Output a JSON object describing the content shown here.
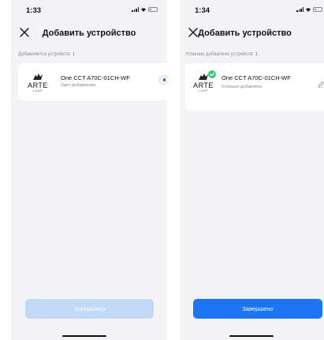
{
  "screens": [
    {
      "time": "1:33",
      "title": "Добавить устройство",
      "section_label": "Добавляется устройств: 1",
      "device": {
        "brand": "ARTE",
        "brand_sub": "LAMP",
        "name": "One CCT A70C-01CH-WF",
        "status": "Идет добавление",
        "indicator_icon": "loading-icon"
      },
      "button_label": "Завершено",
      "button_state": "disabled"
    },
    {
      "time": "1:34",
      "title": "Добавить устройство",
      "section_label": "Успешно добавлено устройств: 1",
      "device": {
        "brand": "ARTE",
        "brand_sub": "LAMP",
        "name": "One CCT A70C-01CH-WF",
        "status": "Успешно добавлено",
        "indicator_icon": "edit-icon"
      },
      "button_label": "Завершено",
      "button_state": "enabled"
    }
  ],
  "colors": {
    "accent": "#1d74f5",
    "accent_disabled": "#c3d9f8",
    "success": "#2ecc71",
    "background": "#f4f4f6",
    "battery_low": "#e53935"
  }
}
